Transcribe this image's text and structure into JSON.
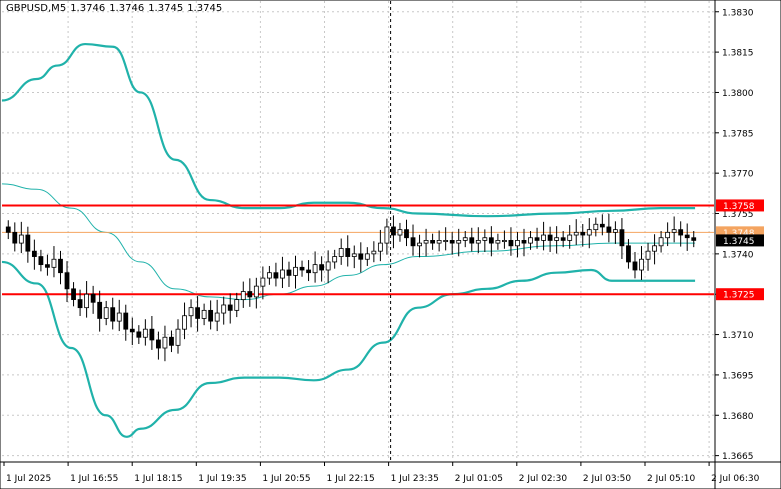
{
  "header": {
    "symbol": "GBPUSD,M5",
    "open": "1.3746",
    "high": "1.3746",
    "low": "1.3745",
    "close": "1.3745"
  },
  "colors": {
    "band": "#20b2aa",
    "level": "#ff0000",
    "bid_line": "#f4a460",
    "price_tag_bg": "#000000",
    "grid": "#c8c8c8"
  },
  "chart_data": {
    "type": "candlestick",
    "symbol": "GBPUSD",
    "timeframe": "M5",
    "ylim": [
      1.3663,
      1.3834
    ],
    "y_ticks": [
      "1.3830",
      "1.3815",
      "1.3800",
      "1.3785",
      "1.3770",
      "1.3755",
      "1.3740",
      "1.3725",
      "1.3710",
      "1.3695",
      "1.3680",
      "1.3665"
    ],
    "x_ticks": [
      "1 Jul 2025",
      "1 Jul 16:55",
      "1 Jul 18:15",
      "1 Jul 19:35",
      "1 Jul 20:55",
      "1 Jul 22:15",
      "1 Jul 23:35",
      "2 Jul 01:05",
      "2 Jul 02:30",
      "2 Jul 03:50",
      "2 Jul 05:10",
      "2 Jul 06:30"
    ],
    "levels": [
      {
        "label": "1.3758",
        "value": 1.3758
      },
      {
        "label": "1.3725",
        "value": 1.3725
      }
    ],
    "bid_line": {
      "label": "1.3748",
      "value": 1.3748
    },
    "current_price": {
      "label": "1.3745",
      "value": 1.3745
    },
    "day_separator_tick": 6,
    "closes": [
      1.3748,
      1.3744,
      1.3747,
      1.3741,
      1.3739,
      1.3736,
      1.3735,
      1.3738,
      1.3733,
      1.3727,
      1.3723,
      1.372,
      1.3725,
      1.3722,
      1.3716,
      1.372,
      1.3715,
      1.3718,
      1.3712,
      1.3711,
      1.3709,
      1.3712,
      1.3708,
      1.3705,
      1.3709,
      1.3706,
      1.3712,
      1.3717,
      1.372,
      1.3716,
      1.3719,
      1.3715,
      1.3718,
      1.3721,
      1.3719,
      1.3723,
      1.3726,
      1.3724,
      1.3728,
      1.3731,
      1.3733,
      1.3731,
      1.3734,
      1.3732,
      1.3735,
      1.3734,
      1.3733,
      1.3736,
      1.3734,
      1.3737,
      1.3739,
      1.3742,
      1.3739,
      1.374,
      1.3738,
      1.374,
      1.3741,
      1.3744,
      1.375,
      1.3747,
      1.3749,
      1.3746,
      1.3743,
      1.3744,
      1.3745,
      1.3744,
      1.3745,
      1.3745,
      1.3744,
      1.3745,
      1.3746,
      1.3744,
      1.3745,
      1.3746,
      1.3744,
      1.3745,
      1.3745,
      1.3743,
      1.3745,
      1.3744,
      1.3746,
      1.3745,
      1.3747,
      1.3745,
      1.3746,
      1.3745,
      1.3747,
      1.3748,
      1.3747,
      1.3749,
      1.3751,
      1.375,
      1.3748,
      1.3749,
      1.3743,
      1.3737,
      1.3734,
      1.3738,
      1.3741,
      1.3743,
      1.3746,
      1.3748,
      1.3749,
      1.3747,
      1.3746,
      1.3745
    ],
    "bands": {
      "upper": [
        [
          0,
          1.3797
        ],
        [
          0.05,
          1.3805
        ],
        [
          0.08,
          1.381
        ],
        [
          0.12,
          1.3818
        ],
        [
          0.16,
          1.3817
        ],
        [
          0.2,
          1.38
        ],
        [
          0.25,
          1.3775
        ],
        [
          0.3,
          1.376
        ],
        [
          0.35,
          1.3757
        ],
        [
          0.4,
          1.3757
        ],
        [
          0.45,
          1.3759
        ],
        [
          0.5,
          1.3759
        ],
        [
          0.55,
          1.3757
        ],
        [
          0.6,
          1.3755
        ],
        [
          0.7,
          1.3754
        ],
        [
          0.8,
          1.3755
        ],
        [
          0.88,
          1.3756
        ],
        [
          0.95,
          1.3757
        ],
        [
          1,
          1.3757
        ]
      ],
      "middle": [
        [
          0,
          1.3766
        ],
        [
          0.05,
          1.3764
        ],
        [
          0.1,
          1.3757
        ],
        [
          0.15,
          1.3748
        ],
        [
          0.2,
          1.3737
        ],
        [
          0.25,
          1.3727
        ],
        [
          0.3,
          1.3724
        ],
        [
          0.35,
          1.3723
        ],
        [
          0.4,
          1.3725
        ],
        [
          0.45,
          1.3728
        ],
        [
          0.5,
          1.3732
        ],
        [
          0.55,
          1.3736
        ],
        [
          0.6,
          1.3739
        ],
        [
          0.7,
          1.3741
        ],
        [
          0.8,
          1.3743
        ],
        [
          0.88,
          1.3744
        ],
        [
          0.95,
          1.3744
        ],
        [
          1,
          1.3744
        ]
      ],
      "lower": [
        [
          0,
          1.3737
        ],
        [
          0.05,
          1.3729
        ],
        [
          0.1,
          1.3705
        ],
        [
          0.15,
          1.368
        ],
        [
          0.18,
          1.3672
        ],
        [
          0.2,
          1.3675
        ],
        [
          0.25,
          1.3682
        ],
        [
          0.3,
          1.3692
        ],
        [
          0.35,
          1.3694
        ],
        [
          0.4,
          1.3694
        ],
        [
          0.45,
          1.3693
        ],
        [
          0.5,
          1.3697
        ],
        [
          0.55,
          1.3707
        ],
        [
          0.6,
          1.372
        ],
        [
          0.65,
          1.3725
        ],
        [
          0.7,
          1.3727
        ],
        [
          0.75,
          1.373
        ],
        [
          0.8,
          1.3733
        ],
        [
          0.85,
          1.3734
        ],
        [
          0.88,
          1.373
        ],
        [
          0.95,
          1.373
        ],
        [
          1,
          1.373
        ]
      ]
    }
  }
}
